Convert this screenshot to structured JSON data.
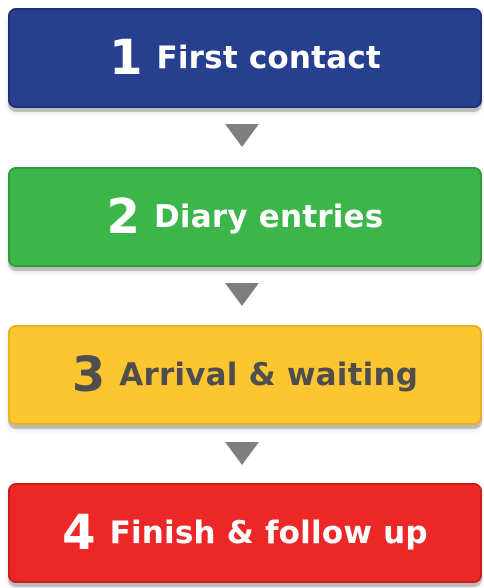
{
  "steps": [
    {
      "number": "1",
      "label": "First contact",
      "color": "#263f8e"
    },
    {
      "number": "2",
      "label": "Diary entries",
      "color": "#3cb54a"
    },
    {
      "number": "3",
      "label": "Arrival & waiting",
      "color": "#fdc52f"
    },
    {
      "number": "4",
      "label": "Finish & follow up",
      "color": "#ec2727"
    }
  ],
  "connector": {
    "icon": "triangle-down-icon",
    "color": "#7e7e7e"
  }
}
